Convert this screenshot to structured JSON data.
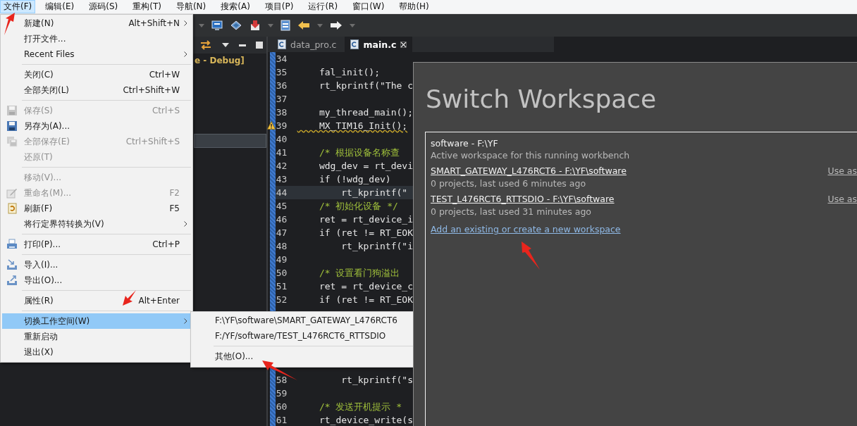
{
  "menubar": [
    {
      "label": "文件(F)",
      "selected": true
    },
    {
      "label": "编辑(E)",
      "selected": false
    },
    {
      "label": "源码(S)",
      "selected": false
    },
    {
      "label": "重构(T)",
      "selected": false
    },
    {
      "label": "导航(N)",
      "selected": false
    },
    {
      "label": "搜索(A)",
      "selected": false
    },
    {
      "label": "项目(P)",
      "selected": false
    },
    {
      "label": "运行(R)",
      "selected": false
    },
    {
      "label": "窗口(W)",
      "selected": false
    },
    {
      "label": "帮助(H)",
      "selected": false
    }
  ],
  "left_panel": {
    "project_label": "e - Debug]"
  },
  "editor": {
    "tabs": [
      {
        "label": "data_pro.c",
        "selected": false
      },
      {
        "label": "main.c",
        "selected": true
      }
    ],
    "lines": [
      {
        "kind": "code",
        "number": "34",
        "warning": false,
        "current": false
      },
      {
        "kind": "code",
        "number": "35",
        "text": "    fal_init();",
        "warning": false,
        "current": false
      },
      {
        "kind": "code",
        "number": "36",
        "text": "    rt_kprintf(\"The c",
        "warning": false,
        "current": false
      },
      {
        "kind": "code",
        "number": "37",
        "warning": false,
        "current": false
      },
      {
        "kind": "code",
        "number": "38",
        "text": "    my_thread_main();",
        "warning": false,
        "current": false
      },
      {
        "kind": "code",
        "number": "39",
        "text": "    MX_TIM16_Init();",
        "warning": true,
        "current": false
      },
      {
        "kind": "code",
        "number": "40",
        "warning": false,
        "current": false
      },
      {
        "kind": "comment",
        "number": "41",
        "text": "    /* 根据设备名称查",
        "warning": false,
        "current": false
      },
      {
        "kind": "code",
        "number": "42",
        "text": "    wdg_dev = rt_devi",
        "warning": false,
        "current": false
      },
      {
        "kind": "code",
        "number": "43",
        "text": "    if (!wdg_dev)",
        "warning": false,
        "current": false
      },
      {
        "kind": "code",
        "number": "44",
        "text": "        rt_kprintf(\"",
        "warning": false,
        "current": true
      },
      {
        "kind": "comment",
        "number": "45",
        "text": "    /* 初始化设备 */",
        "warning": false,
        "current": false
      },
      {
        "kind": "code",
        "number": "46",
        "text": "    ret = rt_device_i",
        "warning": false,
        "current": false
      },
      {
        "kind": "code",
        "number": "47",
        "text": "    if (ret != RT_EOK",
        "warning": false,
        "current": false
      },
      {
        "kind": "code",
        "number": "48",
        "text": "        rt_kprintf(\"i",
        "warning": false,
        "current": false
      },
      {
        "kind": "code",
        "number": "49",
        "warning": false,
        "current": false
      },
      {
        "kind": "comment",
        "number": "50",
        "text": "    /* 设置看门狗溢出",
        "warning": false,
        "current": false
      },
      {
        "kind": "code",
        "number": "51",
        "text": "    ret = rt_device_c",
        "warning": false,
        "current": false
      },
      {
        "kind": "code",
        "number": "52",
        "text": "    if (ret != RT_EOK",
        "warning": false,
        "current": false
      },
      {
        "kind": "covered"
      },
      {
        "kind": "code",
        "number": "58",
        "text": "        rt_kprintf(\"s",
        "warning": false,
        "current": false
      },
      {
        "kind": "code",
        "number": "59",
        "warning": false,
        "current": false
      },
      {
        "kind": "comment",
        "number": "60",
        "text": "    /* 发送开机提示 *",
        "warning": false,
        "current": false
      },
      {
        "kind": "code",
        "number": "61",
        "text": "    rt_device_write(s",
        "warning": false,
        "current": false
      }
    ]
  },
  "file_menu": [
    {
      "kind": "item",
      "label": "新建(N)",
      "shortcut": "Alt+Shift+N",
      "submenu": true,
      "disabled": false,
      "selected": false
    },
    {
      "kind": "item",
      "label": "打开文件...",
      "submenu": false,
      "disabled": false,
      "selected": false
    },
    {
      "kind": "item",
      "label": "Recent Files",
      "submenu": true,
      "disabled": false,
      "selected": false
    },
    {
      "kind": "separator"
    },
    {
      "kind": "item",
      "label": "关闭(C)",
      "shortcut": "Ctrl+W",
      "submenu": false,
      "disabled": false,
      "selected": false
    },
    {
      "kind": "item",
      "label": "全部关闭(L)",
      "shortcut": "Ctrl+Shift+W",
      "submenu": false,
      "disabled": false,
      "selected": false
    },
    {
      "kind": "separator"
    },
    {
      "kind": "item",
      "label": "保存(S)",
      "shortcut": "Ctrl+S",
      "submenu": false,
      "disabled": true,
      "selected": false
    },
    {
      "kind": "item",
      "label": "另存为(A)...",
      "submenu": false,
      "disabled": false,
      "selected": false
    },
    {
      "kind": "item",
      "label": "全部保存(E)",
      "shortcut": "Ctrl+Shift+S",
      "submenu": false,
      "disabled": true,
      "selected": false
    },
    {
      "kind": "item",
      "label": "还原(T)",
      "submenu": false,
      "disabled": true,
      "selected": false
    },
    {
      "kind": "separator"
    },
    {
      "kind": "item",
      "label": "移动(V)...",
      "submenu": false,
      "disabled": true,
      "selected": false
    },
    {
      "kind": "item",
      "label": "重命名(M)...",
      "shortcut": "F2",
      "submenu": false,
      "disabled": true,
      "selected": false
    },
    {
      "kind": "item",
      "label": "刷新(F)",
      "shortcut": "F5",
      "submenu": false,
      "disabled": false,
      "selected": false
    },
    {
      "kind": "item",
      "label": "将行定界符转换为(V)",
      "submenu": true,
      "disabled": false,
      "selected": false
    },
    {
      "kind": "separator"
    },
    {
      "kind": "item",
      "label": "打印(P)...",
      "shortcut": "Ctrl+P",
      "submenu": false,
      "disabled": false,
      "selected": false
    },
    {
      "kind": "separator"
    },
    {
      "kind": "item",
      "label": "导入(I)...",
      "submenu": false,
      "disabled": false,
      "selected": false
    },
    {
      "kind": "item",
      "label": "导出(O)...",
      "submenu": false,
      "disabled": false,
      "selected": false
    },
    {
      "kind": "separator"
    },
    {
      "kind": "item",
      "label": "属性(R)",
      "shortcut": "Alt+Enter",
      "submenu": false,
      "disabled": false,
      "selected": false
    },
    {
      "kind": "separator"
    },
    {
      "kind": "item",
      "label": "切换工作空间(W)",
      "submenu": true,
      "disabled": false,
      "selected": true
    },
    {
      "kind": "item",
      "label": "重新启动",
      "submenu": false,
      "disabled": false,
      "selected": false
    },
    {
      "kind": "item",
      "label": "退出(X)",
      "submenu": false,
      "disabled": false,
      "selected": false
    }
  ],
  "workspace_submenu": [
    {
      "kind": "item",
      "label": "F:\\YF\\software\\SMART_GATEWAY_L476RCT6"
    },
    {
      "kind": "item",
      "label": "F:/YF/software/TEST_L476RCT6_RTTSDIO"
    },
    {
      "kind": "separator"
    },
    {
      "kind": "item",
      "label": "其他(O)..."
    }
  ],
  "dialog": {
    "title": "Switch Workspace",
    "active": {
      "name": "software - F:\\YF",
      "description": "Active workspace for this running workbench"
    },
    "recent": [
      {
        "name": "SMART_GATEWAY_L476RCT6 - F:\\YF\\software",
        "detail": "0 projects, last used 6 minutes ago",
        "action": "Use as"
      },
      {
        "name": "TEST_L476RCT6_RTTSDIO - F:\\YF\\software",
        "detail": "0 projects, last used 31 minutes ago",
        "action": "Use as"
      }
    ],
    "add_link": "Add an existing or create a new workspace"
  }
}
